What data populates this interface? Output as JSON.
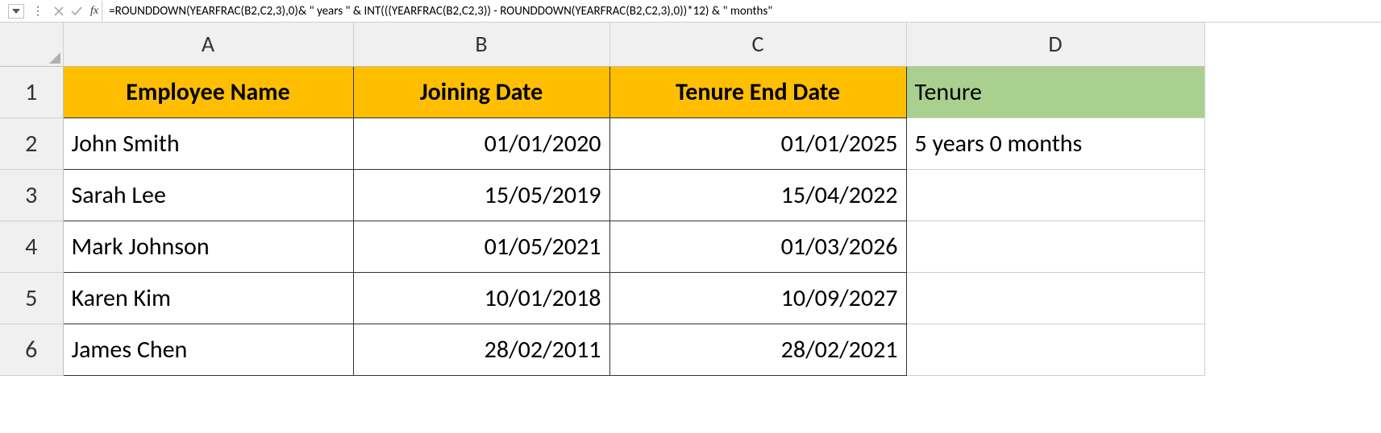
{
  "formula_bar": {
    "fx_label": "fx",
    "formula": "=ROUNDDOWN(YEARFRAC(B2,C2,3),0)& \" years \" & INT(((YEARFRAC(B2,C2,3)) - ROUNDDOWN(YEARFRAC(B2,C2,3),0))*12) & \" months\""
  },
  "columns": {
    "a": "A",
    "b": "B",
    "c": "C",
    "d": "D"
  },
  "rows": {
    "r1": "1",
    "r2": "2",
    "r3": "3",
    "r4": "4",
    "r5": "5",
    "r6": "6"
  },
  "headers": {
    "a": "Employee Name",
    "b": "Joining Date",
    "c": "Tenure End Date",
    "d": "Tenure"
  },
  "data": [
    {
      "name": "John Smith",
      "join": "01/01/2020",
      "end": "01/01/2025",
      "tenure": "5 years 0 months"
    },
    {
      "name": "Sarah Lee",
      "join": "15/05/2019",
      "end": "15/04/2022",
      "tenure": ""
    },
    {
      "name": "Mark Johnson",
      "join": "01/05/2021",
      "end": "01/03/2026",
      "tenure": ""
    },
    {
      "name": "Karen Kim",
      "join": "10/01/2018",
      "end": "10/09/2027",
      "tenure": ""
    },
    {
      "name": "James Chen",
      "join": "28/02/2011",
      "end": "28/02/2021",
      "tenure": ""
    }
  ]
}
